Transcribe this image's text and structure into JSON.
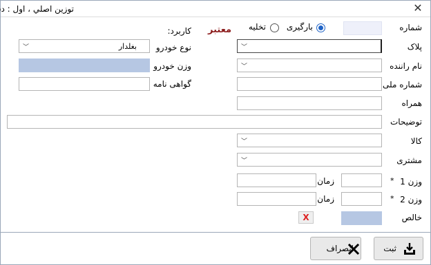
{
  "window": {
    "title": "توزين اصلي ، اول : دستي",
    "close_glyph": "✕"
  },
  "form": {
    "number_label": "شماره",
    "load_type": {
      "loading_label": "بارگيری",
      "unloading_label": "تخليه",
      "selected": "loading"
    },
    "status_text": "معتبر",
    "usage_label": "کاربرد:",
    "plate_label": "پلاک",
    "vehicle_type_label": "نوع خودرو",
    "vehicle_type_value": "بغلدار",
    "driver_name_label": "نام راننده",
    "vehicle_weight_label": "وزن خودرو",
    "national_id_label": "شماره ملی",
    "license_label": "گواهی نامه",
    "mobile_label": "همراه",
    "description_label": "توضيحات",
    "goods_label": "کالا",
    "customer_label": "مشتری",
    "weight1_label": "وزن 1",
    "weight2_label": "وزن 2",
    "time_label": "زمان",
    "required_mark": "*",
    "net_label": "خالص",
    "clear_glyph": "X"
  },
  "footer": {
    "submit_label": "ثبت",
    "cancel_label": "انصراف"
  },
  "icons": {
    "dropdown": "chevron-down-icon",
    "submit": "download-tray-icon",
    "cancel": "x-mark-icon"
  },
  "colors": {
    "readonly_field": "#b6c7e3",
    "status_text": "#8b1a1a",
    "radio_selected": "#1f63c6"
  }
}
